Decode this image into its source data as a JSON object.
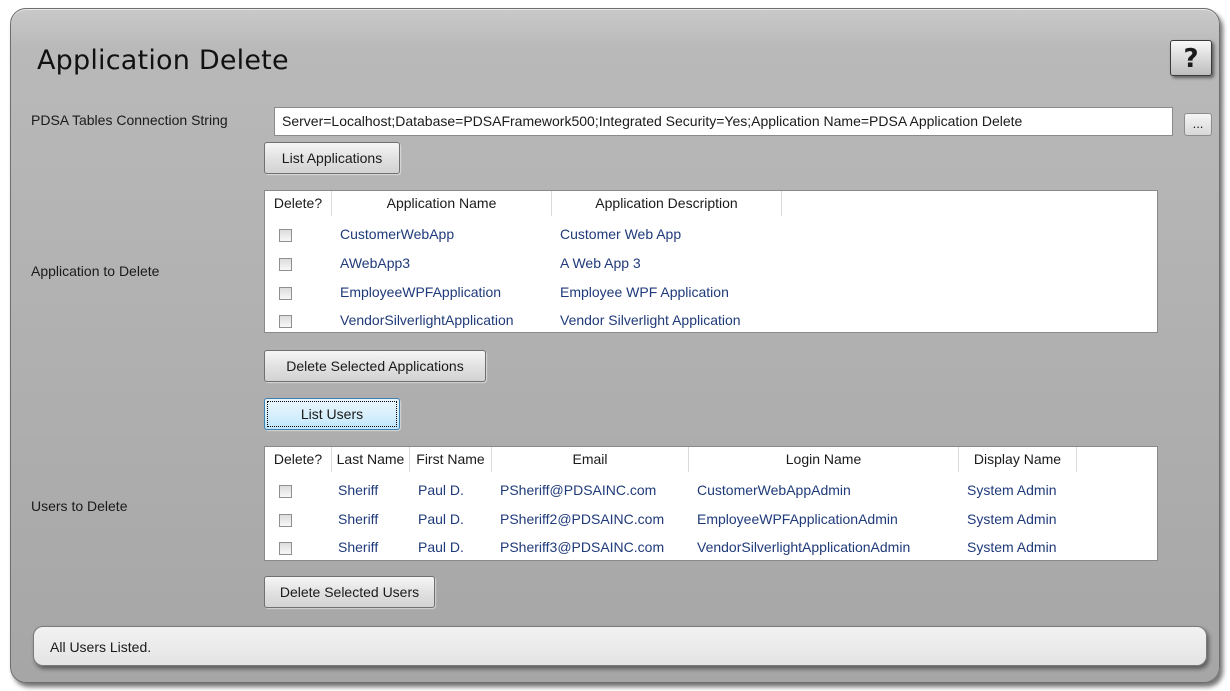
{
  "title": "Application Delete",
  "help_label": "?",
  "connection": {
    "label": "PDSA Tables Connection String",
    "value": "Server=Localhost;Database=PDSAFramework500;Integrated Security=Yes;Application Name=PDSA Application Delete",
    "browse_label": "..."
  },
  "applications": {
    "list_button": "List Applications",
    "section_label": "Application to Delete",
    "headers": [
      "Delete?",
      "Application Name",
      "Application Description"
    ],
    "rows": [
      {
        "checked": false,
        "name": "CustomerWebApp",
        "description": "Customer Web App"
      },
      {
        "checked": false,
        "name": "AWebApp3",
        "description": "A Web App 3"
      },
      {
        "checked": false,
        "name": "EmployeeWPFApplication",
        "description": "Employee WPF Application"
      },
      {
        "checked": false,
        "name": "VendorSilverlightApplication",
        "description": "Vendor Silverlight Application"
      }
    ],
    "delete_button": "Delete Selected Applications"
  },
  "users": {
    "list_button": "List Users",
    "section_label": "Users to Delete",
    "headers": [
      "Delete?",
      "Last Name",
      "First Name",
      "Email",
      "Login Name",
      "Display Name"
    ],
    "rows": [
      {
        "checked": false,
        "last": "Sheriff",
        "first": "Paul D.",
        "email": "PSheriff@PDSAINC.com",
        "login": "CustomerWebAppAdmin",
        "display": "System Admin"
      },
      {
        "checked": false,
        "last": "Sheriff",
        "first": "Paul D.",
        "email": "PSheriff2@PDSAINC.com",
        "login": "EmployeeWPFApplicationAdmin",
        "display": "System Admin"
      },
      {
        "checked": false,
        "last": "Sheriff",
        "first": "Paul D.",
        "email": "PSheriff3@PDSAINC.com",
        "login": "VendorSilverlightApplicationAdmin",
        "display": "System Admin"
      }
    ],
    "delete_button": "Delete Selected Users"
  },
  "status": "All Users Listed.",
  "colors": {
    "cell_text": "#1f3a7a",
    "window_bg": "#b9b9b9"
  }
}
